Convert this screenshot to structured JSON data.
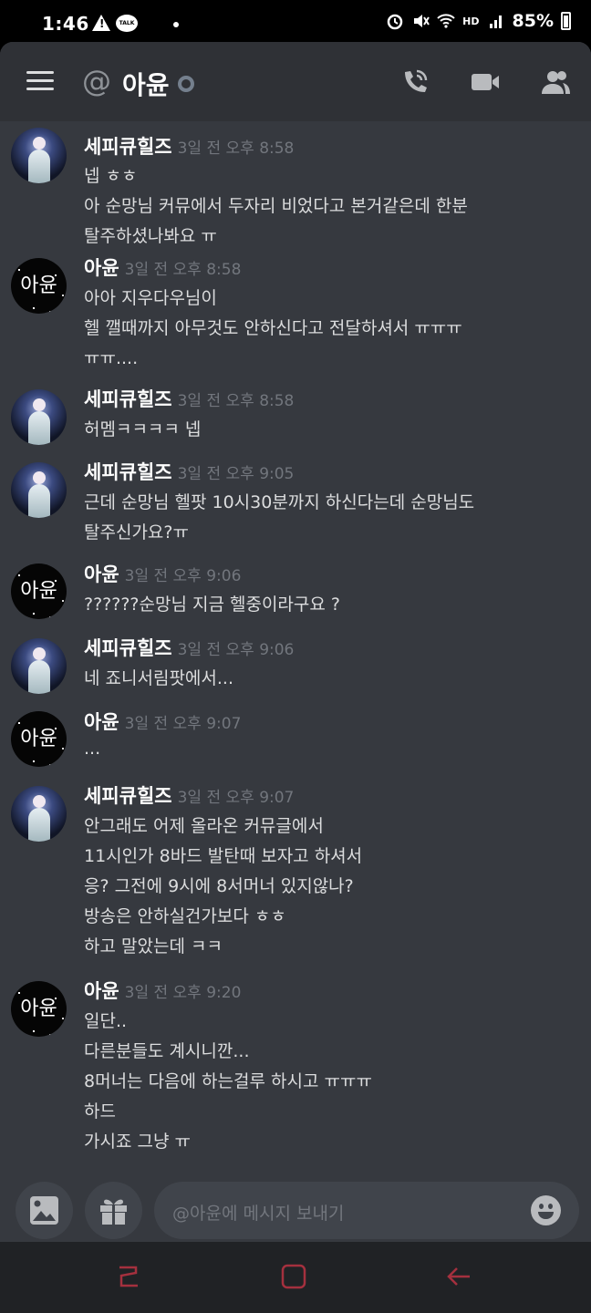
{
  "status_bar": {
    "time": "1:46",
    "talk_badge": "TALK",
    "battery": "85%",
    "network": "HD"
  },
  "header": {
    "at_symbol": "@",
    "channel_name": "아윤",
    "icons": [
      "menu-icon",
      "call-icon",
      "video-icon",
      "members-icon"
    ]
  },
  "messages": [
    {
      "author": "세피큐힐즈",
      "avatar": "sepi",
      "time": "3일 전 오후 8:58",
      "lines": [
        "넵 ㅎㅎ",
        "아 순망님 커뮤에서 두자리 비었다고 본거같은데 한분",
        "탈주하셨나봐요 ㅠ"
      ]
    },
    {
      "author": "아윤",
      "avatar": "ayun",
      "avatar_text": "아윤",
      "time": "3일 전 오후 8:58",
      "lines": [
        "아아 지우다우님이",
        "헬 깰때까지 아무것도 안하신다고 전달하셔서 ㅠㅠㅠ",
        "ㅠㅠ...."
      ]
    },
    {
      "author": "세피큐힐즈",
      "avatar": "sepi",
      "time": "3일 전 오후 8:58",
      "lines": [
        "허멤ㅋㅋㅋㅋ 넵"
      ]
    },
    {
      "author": "세피큐힐즈",
      "avatar": "sepi",
      "time": "3일 전 오후 9:05",
      "lines": [
        "근데 순망님 헬팟 10시30분까지 하신다는데 순망님도",
        "탈주신가요?ㅠ"
      ]
    },
    {
      "author": "아윤",
      "avatar": "ayun",
      "avatar_text": "아윤",
      "time": "3일 전 오후 9:06",
      "lines": [
        "??????순망님 지금 헬중이라구요 ?"
      ]
    },
    {
      "author": "세피큐힐즈",
      "avatar": "sepi",
      "time": "3일 전 오후 9:06",
      "lines": [
        "네 죠니서림팟에서..."
      ]
    },
    {
      "author": "아윤",
      "avatar": "ayun",
      "avatar_text": "아윤",
      "time": "3일 전 오후 9:07",
      "lines": [
        "..."
      ]
    },
    {
      "author": "세피큐힐즈",
      "avatar": "sepi",
      "time": "3일 전 오후 9:07",
      "lines": [
        "안그래도 어제 올라온 커뮤글에서",
        "11시인가 8바드 발탄때 보자고 하셔서",
        "응? 그전에 9시에 8서머너 있지않나?",
        "방송은 안하실건가보다 ㅎㅎ",
        "하고 말았는데 ㅋㅋ"
      ]
    },
    {
      "author": "아윤",
      "avatar": "ayun",
      "avatar_text": "아윤",
      "time": "3일 전 오후 9:20",
      "lines": [
        "일단..",
        "다른분들도 계시니깐...",
        "8머너는 다음에 하는걸루 하시고 ㅠㅠㅠ",
        "하드",
        "가시죠 그냥 ㅠ"
      ]
    }
  ],
  "composer": {
    "placeholder": "@아윤에 메시지 보내기",
    "icons": [
      "image-icon",
      "gift-icon",
      "emoji-icon"
    ]
  },
  "colors": {
    "background": "#36393f",
    "header": "#2f3136",
    "input": "#40444b",
    "timestamp": "#72767d",
    "navbar": "#202225",
    "nav_icon": "#a4303e"
  }
}
